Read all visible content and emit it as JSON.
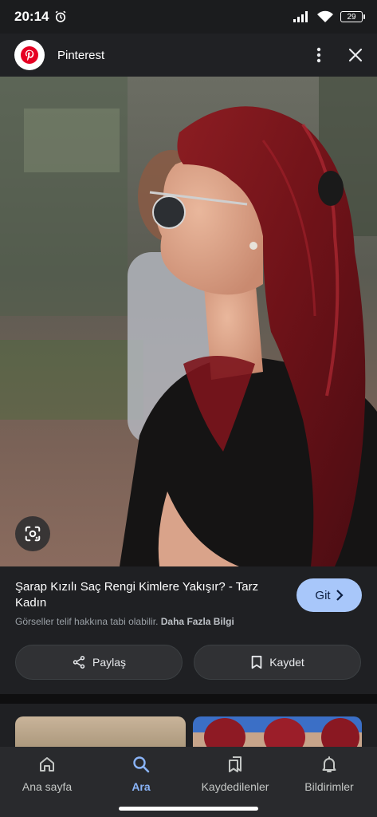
{
  "status_bar": {
    "time": "20:14",
    "battery": "29",
    "icons": [
      "alarm-icon",
      "signal-icon",
      "wifi-icon",
      "battery-icon"
    ]
  },
  "header": {
    "app_name": "Pinterest",
    "icons": [
      "pinterest-logo",
      "more-vert-icon",
      "close-icon"
    ]
  },
  "image": {
    "lens_icon": "google-lens-icon"
  },
  "result": {
    "title": "Şarap Kızılı Saç Rengi Kimlere Yakışır? - Tarz Kadın",
    "go_label": "Git",
    "copyright_text": "Görseller telif hakkına tabi olabilir.",
    "learn_more": "Daha Fazla Bilgi",
    "share_label": "Paylaş",
    "save_label": "Kaydet"
  },
  "bottom_nav": {
    "items": [
      {
        "label": "Ana sayfa",
        "icon": "home-icon",
        "active": false
      },
      {
        "label": "Ara",
        "icon": "search-icon",
        "active": true
      },
      {
        "label": "Kaydedilenler",
        "icon": "bookmarks-icon",
        "active": false
      },
      {
        "label": "Bildirimler",
        "icon": "bell-icon",
        "active": false
      }
    ]
  },
  "colors": {
    "accent": "#a8c7fa",
    "active_nav": "#8ab4f8",
    "surface": "#1f2023",
    "pinterest_red": "#e60023"
  }
}
